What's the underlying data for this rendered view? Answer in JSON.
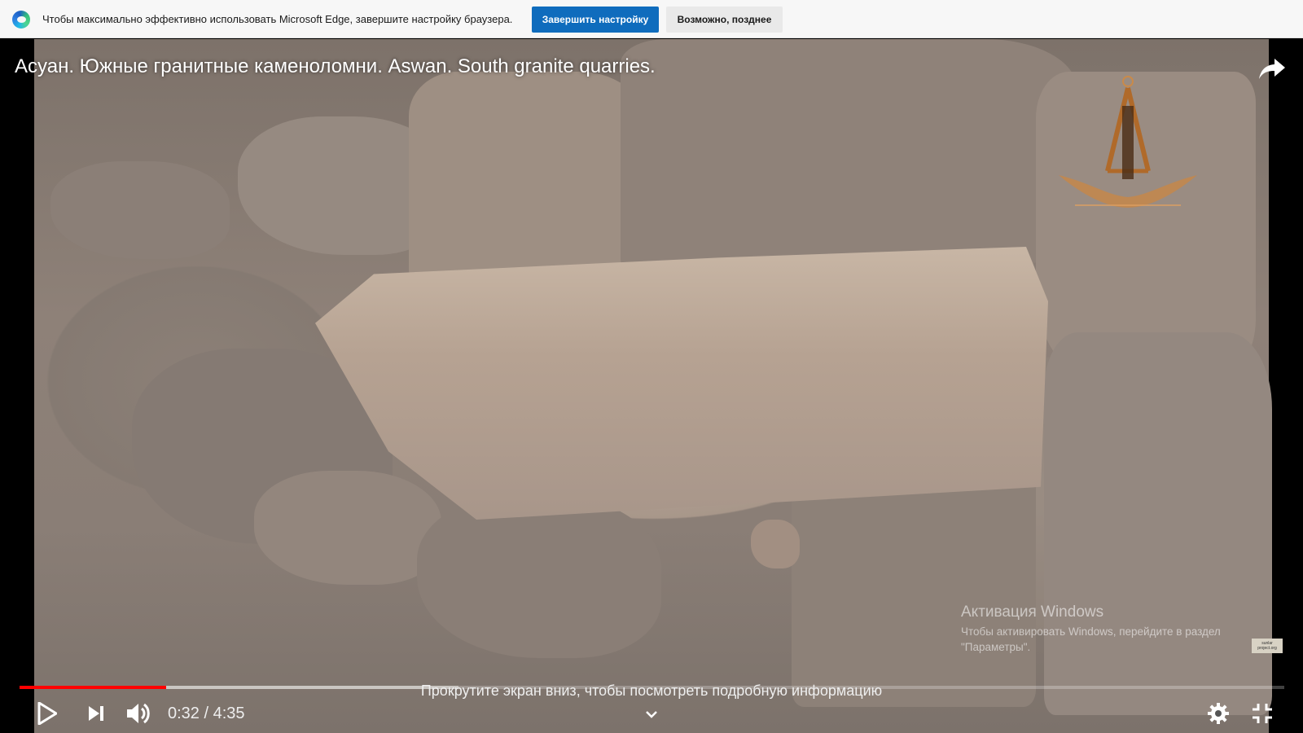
{
  "edge_bar": {
    "message": "Чтобы максимально эффективно использовать Microsoft Edge, завершите настройку браузера.",
    "primary_button": "Завершить настройку",
    "secondary_button": "Возможно, позднее"
  },
  "video": {
    "title": "Асуан. Южные гранитные каменоломни. Aswan. South granite quarries.",
    "current_time": "0:32",
    "duration": "4:35",
    "time_display": "0:32 / 4:35",
    "played_fraction": 0.116,
    "buffered_fraction": 0.347,
    "scroll_hint": "Прокрутите экран вниз, чтобы посмотреть подробную информацию"
  },
  "windows_activation": {
    "title": "Активация Windows",
    "line1": "Чтобы активировать Windows, перейдите в раздел",
    "line2": "\"Параметры\"."
  },
  "watermark_text": "sunlar project.org",
  "icons": {
    "edge": "edge-logo-icon",
    "share": "share-arrow-icon",
    "play": "play-icon",
    "next": "next-track-icon",
    "volume": "volume-icon",
    "settings": "gear-icon",
    "exit_fullscreen": "exit-fullscreen-icon",
    "chevron": "chevron-down-icon"
  },
  "colors": {
    "edge_primary": "#0f6cbd",
    "progress_played": "#ff0000"
  }
}
